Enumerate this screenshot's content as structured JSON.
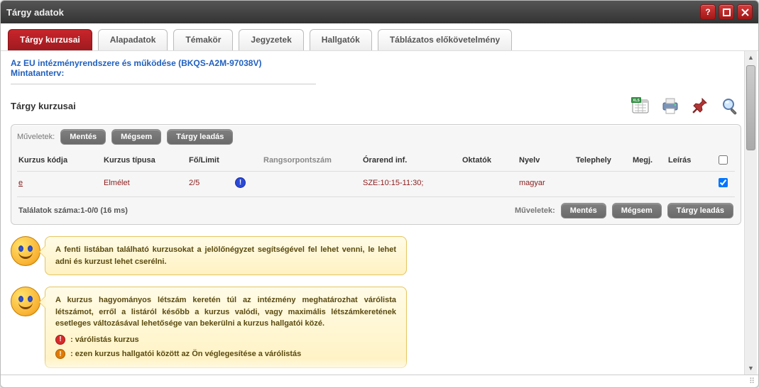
{
  "window": {
    "title": "Tárgy adatok"
  },
  "tabs": [
    {
      "label": "Tárgy kurzusai",
      "active": true
    },
    {
      "label": "Alapadatok"
    },
    {
      "label": "Témakör"
    },
    {
      "label": "Jegyzetek"
    },
    {
      "label": "Hallgatók"
    },
    {
      "label": "Táblázatos előkövetelmény"
    }
  ],
  "subject_link": "Az EU intézményrendszere és működése (BKQS-A2M-97038V)",
  "mintatanterv_label": "Mintatanterv:",
  "section_title": "Tárgy kurzusai",
  "toolbar_icons": {
    "xls": "xls-export-icon",
    "print": "print-icon",
    "pin": "pin-icon",
    "search": "search-icon"
  },
  "ops_label": "Műveletek:",
  "buttons": {
    "save": "Mentés",
    "cancel": "Mégsem",
    "drop": "Tárgy leadás"
  },
  "grid": {
    "headers": {
      "code": "Kurzus kódja",
      "type": "Kurzus típusa",
      "limit": "Fő/Limit",
      "rank": "Rangsorpontszám",
      "schedule": "Órarend inf.",
      "teachers": "Oktatók",
      "lang": "Nyelv",
      "site": "Telephely",
      "note": "Megj.",
      "desc": "Leírás"
    },
    "row": {
      "code": "e",
      "type": "Elmélet",
      "limit": "2/5",
      "schedule": "SZE:10:15-11:30;",
      "teachers": "",
      "lang": "magyar",
      "site": "",
      "note": "",
      "desc": ""
    },
    "results_text": "Találatok száma:1-0/0 (16 ms)"
  },
  "hint1": "A fenti listában található kurzusokat a jelölőnégyzet segítségével fel lehet venni, le lehet adni és kurzust lehet cserélni.",
  "hint2_main": "A kurzus hagyományos létszám keretén túl az intézmény meghatározhat várólista létszámot, erről a listáról később a kurzus valódi, vagy maximális létszámkeretének esetleges változásával lehetősége van bekerülni a kurzus hallgatói közé.",
  "hint2_bullet1": ": várólistás kurzus",
  "hint2_bullet2": ": ezen kurzus hallgatói között az Ön véglegesítése a várólistás"
}
